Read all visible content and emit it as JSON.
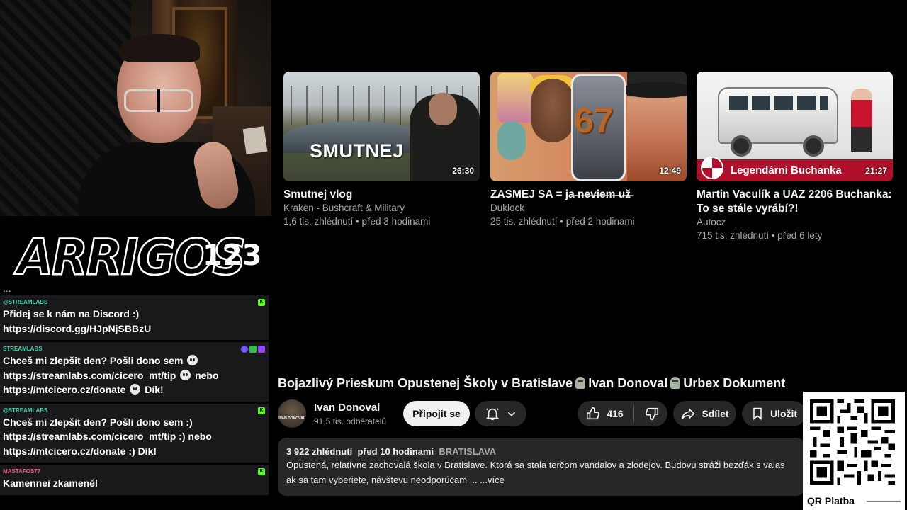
{
  "logo": {
    "brand": "ARRIGOS",
    "number": "123"
  },
  "chat": {
    "cut_text": "...",
    "messages": [
      {
        "user": "@STREAMLABS",
        "user_color": "#3ed1a8",
        "badges": [
          "kick"
        ],
        "lines": [
          "Přidej se k nám na Discord :)",
          "https://discord.gg/HJpNjSBBzU"
        ]
      },
      {
        "user": "STREAMLABS",
        "user_color": "#3ed1a8",
        "badges": [
          "twitch-blue",
          "green",
          "twitch"
        ],
        "lines": [
          "Chceš mi zlepšit den? Pošli dono sem",
          "https://streamlabs.com/cicero_mt/tip",
          "nebo",
          "https://mtcicero.cz/donate",
          "Dík!"
        ]
      },
      {
        "user": "@STREAMLABS",
        "user_color": "#3ed1a8",
        "badges": [
          "kick"
        ],
        "lines": [
          "Chceš mi zlepšit den? Pošli dono sem :)",
          "https://streamlabs.com/cicero_mt/tip :) nebo",
          "https://mtcicero.cz/donate :) Dík!"
        ]
      },
      {
        "user": "MASTAFOS77",
        "user_color": "#e8608a",
        "badges": [
          "kick"
        ],
        "lines": [
          "Kamennei zkameněl"
        ]
      }
    ]
  },
  "recommended": [
    {
      "thumb_text": "SMUTNEJ",
      "duration": "26:30",
      "title": "Smutnej vlog",
      "channel": "Kraken - Bushcraft & Military",
      "meta": "1,6 tis. zhlédnutí • před 3 hodinami"
    },
    {
      "thumb_text": "67",
      "duration": "12:49",
      "title": "ZASMEJ SA = ja̶ ̶n̶e̶v̶i̶e̶m̶ ̶u̶ž̶",
      "channel": "Duklock",
      "meta": "25 tis. zhlédnutí • před 2 hodinami"
    },
    {
      "thumb_text": "Legendární Buchanka",
      "duration": "21:27",
      "title": "Martin Vaculík a UAZ 2206 Buchanka: To se stále vyrábí?!",
      "channel": "Autocz",
      "meta": "715 tis. zhlédnutí • před 6 lety"
    }
  ],
  "watch": {
    "title_parts": [
      "Bojazlivý Prieskum Opustenej Školy v Bratislave",
      "Ivan Donoval",
      "Urbex Dokument"
    ],
    "channel": {
      "name": "Ivan Donoval",
      "subs": "91,5 tis. odběratelů",
      "avatar_text": "IVAN DONOVAL"
    },
    "join_label": "Připojit se",
    "likes": "416",
    "share_label": "Sdílet",
    "save_label": "Uložit",
    "description": {
      "views": "3 922 zhlédnutí",
      "age": "před 10 hodinami",
      "location": "BRATISLAVA",
      "line1": "Opustená, relatívne zachovalá škola v Bratislave. Ktorá sa stala terčom vandalov a zlodejov. Budovu stráži bezďák s valas",
      "line2": "ak sa tam vyberiete, návštevu neodporúčam ...",
      "more": "...více"
    }
  },
  "qr": {
    "label": "QR Platba"
  }
}
